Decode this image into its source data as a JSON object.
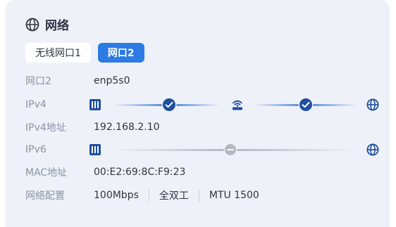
{
  "card": {
    "title": "网络",
    "title_icon": "globe-icon"
  },
  "tabs": [
    {
      "label": "无线网口1",
      "active": false
    },
    {
      "label": "网口2",
      "active": true
    }
  ],
  "rows": {
    "port_label": "网口2",
    "port_value": "enp5s0",
    "ipv4_label": "IPv4",
    "ipv4_addr_label": "IPv4地址",
    "ipv4_addr_value": "192.168.2.10",
    "ipv6_label": "IPv6",
    "mac_label": "MAC地址",
    "mac_value": "00:E2:69:8C:F9:23",
    "cfg_label": "网络配置",
    "cfg_speed": "100Mbps",
    "cfg_duplex": "全双工",
    "cfg_mtu": "MTU 1500"
  },
  "ipv4_status": {
    "nodes": [
      "ethernet-port-icon",
      "check-circle-icon",
      "router-icon",
      "check-circle-icon",
      "globe-icon"
    ],
    "state": "connected"
  },
  "ipv6_status": {
    "nodes": [
      "ethernet-port-icon",
      "minus-circle-icon",
      "globe-icon"
    ],
    "state": "disconnected"
  },
  "colors": {
    "accent": "#2c7be5",
    "connected_icon": "#1f4f9e",
    "disconnected": "#b3b8c2",
    "background": "#eef2f8"
  }
}
